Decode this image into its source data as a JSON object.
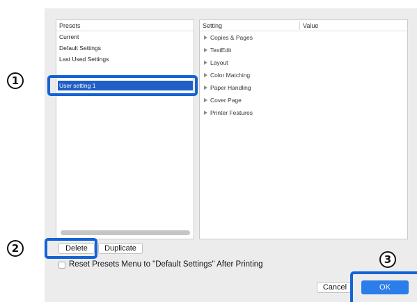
{
  "presets": {
    "header": "Presets",
    "items": [
      {
        "label": "Current"
      },
      {
        "label": "Default Settings"
      },
      {
        "label": "Last Used Settings"
      },
      {
        "label": "User setting 1",
        "selected": true
      }
    ]
  },
  "settings": {
    "col_setting": "Setting",
    "col_value": "Value",
    "rows": [
      {
        "label": "Copies & Pages"
      },
      {
        "label": "TextEdit"
      },
      {
        "label": "Layout"
      },
      {
        "label": "Color Matching"
      },
      {
        "label": "Paper Handling"
      },
      {
        "label": "Cover Page"
      },
      {
        "label": "Printer Features"
      }
    ],
    "disclosure_icon": "triangle-right-icon"
  },
  "buttons": {
    "delete": "Delete",
    "duplicate": "Duplicate",
    "cancel": "Cancel",
    "ok": "OK"
  },
  "checkbox": {
    "label": "Reset Presets Menu to \"Default Settings\" After Printing",
    "checked": false
  },
  "markers": {
    "one": "1",
    "two": "2",
    "three": "3"
  },
  "colors": {
    "selection": "#1f5fc6",
    "highlight": "#1463d6",
    "ok_button": "#2b7de9",
    "dialog_bg": "#ececec"
  }
}
